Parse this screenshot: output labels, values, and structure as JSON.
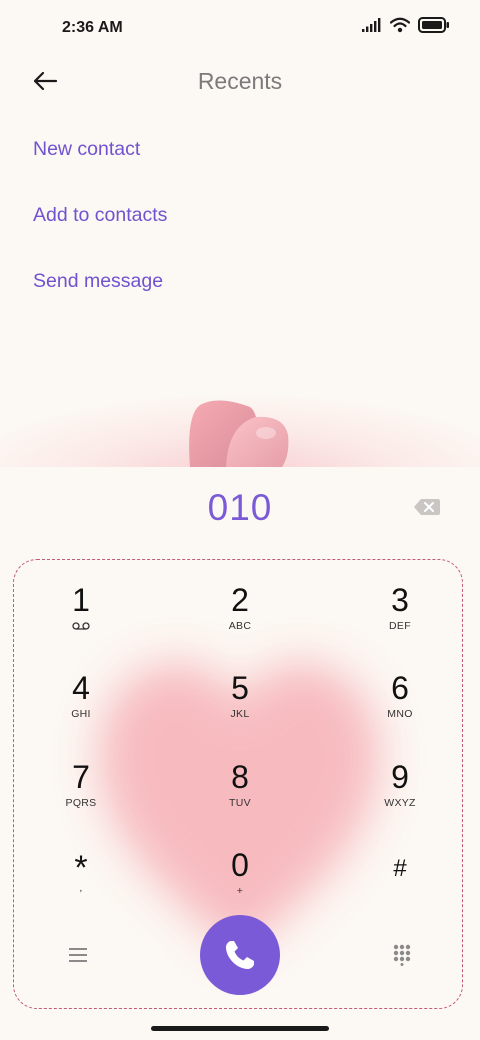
{
  "status_bar": {
    "time": "2:36 AM",
    "icons": [
      "signal-icon",
      "wifi-icon",
      "battery-icon"
    ]
  },
  "header": {
    "title": "Recents",
    "back_icon": "back-arrow-icon"
  },
  "menu": {
    "new_contact": "New contact",
    "add_to_contacts": "Add to contacts",
    "send_message": "Send message"
  },
  "dialer": {
    "number": "010",
    "backspace_icon": "backspace-icon",
    "keys": [
      {
        "digit": "1",
        "letters": ""
      },
      {
        "digit": "2",
        "letters": "ABC"
      },
      {
        "digit": "3",
        "letters": "DEF"
      },
      {
        "digit": "4",
        "letters": "GHI"
      },
      {
        "digit": "5",
        "letters": "JKL"
      },
      {
        "digit": "6",
        "letters": "MNO"
      },
      {
        "digit": "7",
        "letters": "PQRS"
      },
      {
        "digit": "8",
        "letters": "TUV"
      },
      {
        "digit": "9",
        "letters": "WXYZ"
      },
      {
        "digit": "*",
        "letters": ","
      },
      {
        "digit": "0",
        "letters": "+"
      },
      {
        "digit": "#",
        "letters": ""
      }
    ],
    "voicemail_icon": "voicemail-icon",
    "menu_icon": "menu-icon",
    "call_icon": "phone-icon",
    "dialpad_icon": "dialpad-icon"
  },
  "colors": {
    "accent": "#7a5ad6",
    "link": "#7152cf",
    "background": "#fcf8f3",
    "dashed_border": "#c05a7a",
    "heart": "#f7b8bd"
  }
}
